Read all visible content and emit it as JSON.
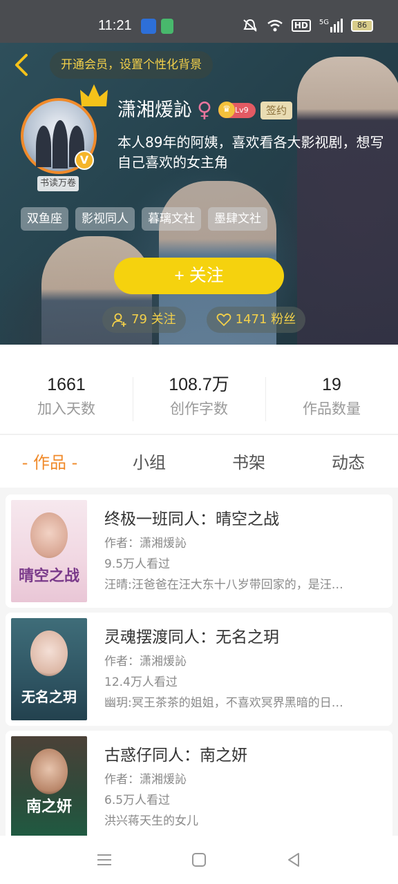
{
  "status_bar": {
    "time": "11:21",
    "net": "5G",
    "battery": "86"
  },
  "header": {
    "vip_banner": "开通会员，设置个性化背景"
  },
  "profile": {
    "username": "潇湘煖訫",
    "gender_symbol": "♀",
    "level": "Lv9",
    "sign_badge": "签约",
    "read_badge": "书读万卷",
    "verified_badge": "V",
    "bio": "本人89年的阿姨，喜欢看各大影视剧，想写自己喜欢的女主角",
    "tags": [
      "双鱼座",
      "影视同人",
      "暮璃文社",
      "墨肆文社"
    ],
    "follow_button": "+  关注",
    "following": "79 关注",
    "fans": "1471 粉丝"
  },
  "stats": [
    {
      "value": "1661",
      "label": "加入天数"
    },
    {
      "value": "108.7万",
      "label": "创作字数"
    },
    {
      "value": "19",
      "label": "作品数量"
    }
  ],
  "tabs": [
    "- 作品 -",
    "小组",
    "书架",
    "动态"
  ],
  "books": [
    {
      "title": "终极一班同人：晴空之战",
      "author": "作者：潇湘煖訫",
      "views": "9.5万人看过",
      "desc": "汪晴:汪爸爸在汪大东十八岁带回家的，是汪…",
      "cover_text": "晴空之战"
    },
    {
      "title": "灵魂摆渡同人：无名之玥",
      "author": "作者：潇湘煖訫",
      "views": "12.4万人看过",
      "desc": "幽玥:冥王茶茶的姐姐，不喜欢冥界黑暗的日…",
      "cover_text": "无名之玥"
    },
    {
      "title": "古惑仔同人：南之妍",
      "author": "作者：潇湘煖訫",
      "views": "6.5万人看过",
      "desc": "洪兴蒋天生的女儿",
      "cover_text": "南之妍"
    }
  ],
  "colors": {
    "accent": "#f08a2a",
    "follow": "#f5d20e",
    "gold_text": "#f3d04a"
  }
}
